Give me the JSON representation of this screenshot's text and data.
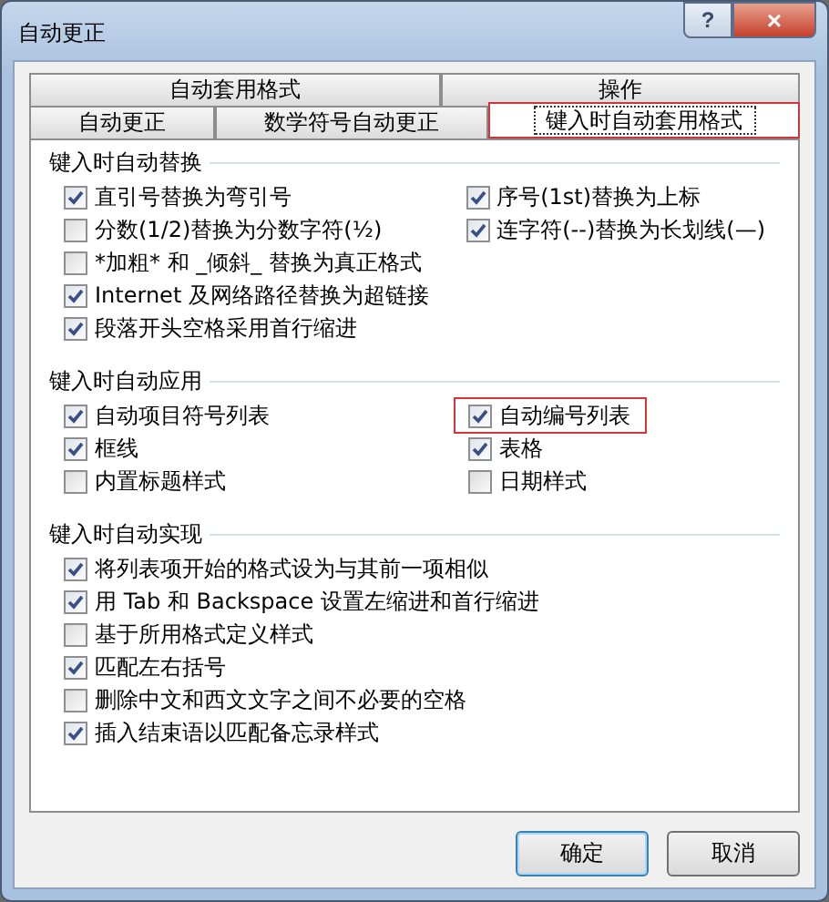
{
  "window": {
    "title": "自动更正",
    "help": "?",
    "close": "×"
  },
  "tab_rows": [
    [
      {
        "label": "自动套用格式",
        "selected": false,
        "highlighted": false
      },
      {
        "label": "操作",
        "selected": false,
        "highlighted": false
      }
    ],
    [
      {
        "label": "自动更正",
        "selected": false,
        "highlighted": false
      },
      {
        "label": "数学符号自动更正",
        "selected": false,
        "highlighted": false
      },
      {
        "label": "键入时自动套用格式",
        "selected": true,
        "highlighted": true
      }
    ]
  ],
  "sections": [
    {
      "title": "键入时自动替换",
      "columns": [
        [
          {
            "label": "直引号替换为弯引号",
            "checked": true,
            "highlighted": false
          },
          {
            "label": "分数(1/2)替换为分数字符(½)",
            "checked": false,
            "highlighted": false
          },
          {
            "label": "*加粗* 和 _倾斜_ 替换为真正格式",
            "checked": false,
            "highlighted": false
          },
          {
            "label": "Internet 及网络路径替换为超链接",
            "checked": true,
            "highlighted": false
          },
          {
            "label": "段落开头空格采用首行缩进",
            "checked": true,
            "highlighted": false
          }
        ],
        [
          {
            "label": "序号(1st)替换为上标",
            "checked": true,
            "highlighted": false
          },
          {
            "label": "连字符(--)替换为长划线(—)",
            "checked": true,
            "highlighted": false
          }
        ]
      ]
    },
    {
      "title": "键入时自动应用",
      "columns": [
        [
          {
            "label": "自动项目符号列表",
            "checked": true,
            "highlighted": false
          },
          {
            "label": "框线",
            "checked": true,
            "highlighted": false
          },
          {
            "label": "内置标题样式",
            "checked": false,
            "highlighted": false
          }
        ],
        [
          {
            "label": "自动编号列表",
            "checked": true,
            "highlighted": true
          },
          {
            "label": "表格",
            "checked": true,
            "highlighted": false
          },
          {
            "label": "日期样式",
            "checked": false,
            "highlighted": false
          }
        ]
      ]
    },
    {
      "title": "键入时自动实现",
      "columns": [
        [
          {
            "label": "将列表项开始的格式设为与其前一项相似",
            "checked": true,
            "highlighted": false
          },
          {
            "label": "用 Tab 和 Backspace 设置左缩进和首行缩进",
            "checked": true,
            "highlighted": false
          },
          {
            "label": "基于所用格式定义样式",
            "checked": false,
            "highlighted": false
          },
          {
            "label": "匹配左右括号",
            "checked": true,
            "highlighted": false
          },
          {
            "label": "删除中文和西文文字之间不必要的空格",
            "checked": false,
            "highlighted": false
          },
          {
            "label": "插入结束语以匹配备忘录样式",
            "checked": true,
            "highlighted": false
          }
        ]
      ]
    }
  ],
  "buttons": [
    "确定",
    "取消"
  ]
}
